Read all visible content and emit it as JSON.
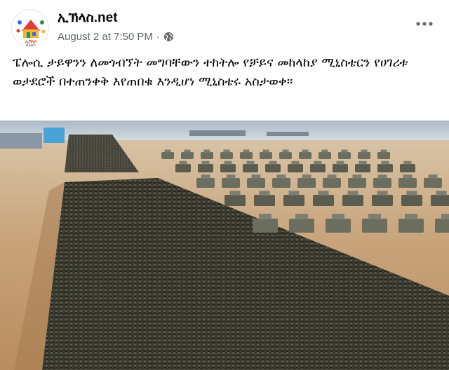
{
  "post": {
    "page_name": "ኢኽላስ.net",
    "timestamp": "August 2 at 7:50 PM",
    "separator": "·",
    "privacy_icon": "globe-icon",
    "more_icon": "more-horizontal-icon",
    "caption": "ፔሎሲ ታይዋንን ለመጎብኘት መግባቸውን ተከትሎ የቻይና መከላከያ ሚኒስቴርን የሀገሪቱ ወታደሮች በተጠንቀቅ እየጠበቁ እንዲሆነ ሚኒስቴሩ አስታወቀ፡፡",
    "avatar_label": "ኢኽላስ",
    "avatar_sub": "IKHLAS"
  },
  "colors": {
    "text_primary": "#050505",
    "text_secondary": "#65676b",
    "sky": "#b8c4cf",
    "ground": "#c49e72"
  },
  "photo": {
    "subject": "military-parade-photo"
  }
}
